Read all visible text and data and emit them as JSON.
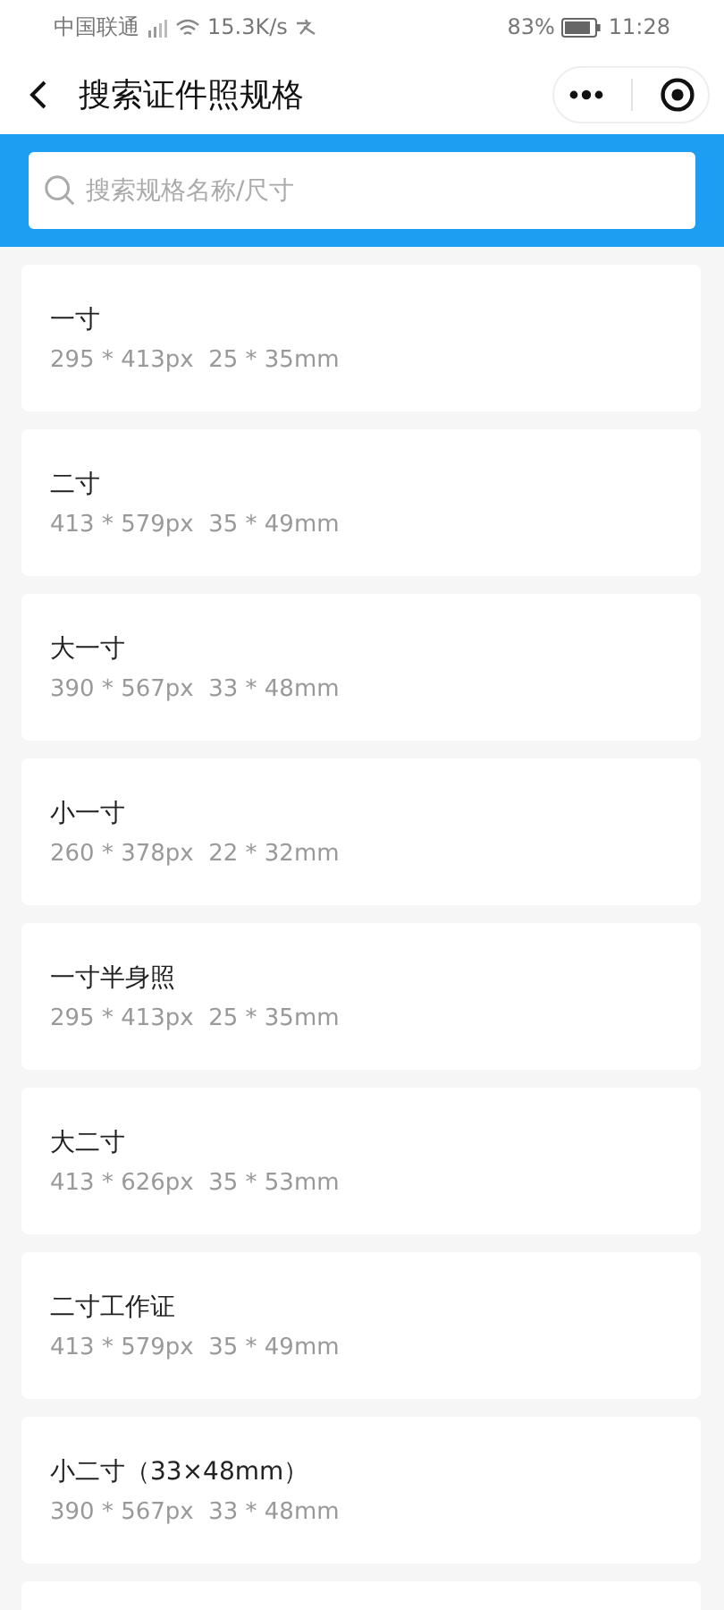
{
  "status_bar": {
    "carrier": "中国联通",
    "speed": "15.3K/s",
    "battery": "83%",
    "time": "11:28"
  },
  "nav": {
    "title": "搜索证件照规格"
  },
  "search": {
    "placeholder": "搜索规格名称/尺寸"
  },
  "specs": [
    {
      "name": "一寸",
      "size": "295 * 413px  25 * 35mm"
    },
    {
      "name": "二寸",
      "size": "413 * 579px  35 * 49mm"
    },
    {
      "name": "大一寸",
      "size": "390 * 567px  33 * 48mm"
    },
    {
      "name": "小一寸",
      "size": "260 * 378px  22 * 32mm"
    },
    {
      "name": "一寸半身照",
      "size": "295 * 413px  25 * 35mm"
    },
    {
      "name": "大二寸",
      "size": "413 * 626px  35 * 53mm"
    },
    {
      "name": "二寸工作证",
      "size": "413 * 579px  35 * 49mm"
    },
    {
      "name": "小二寸（33×48mm）",
      "size": "390 * 567px  33 * 48mm"
    }
  ]
}
